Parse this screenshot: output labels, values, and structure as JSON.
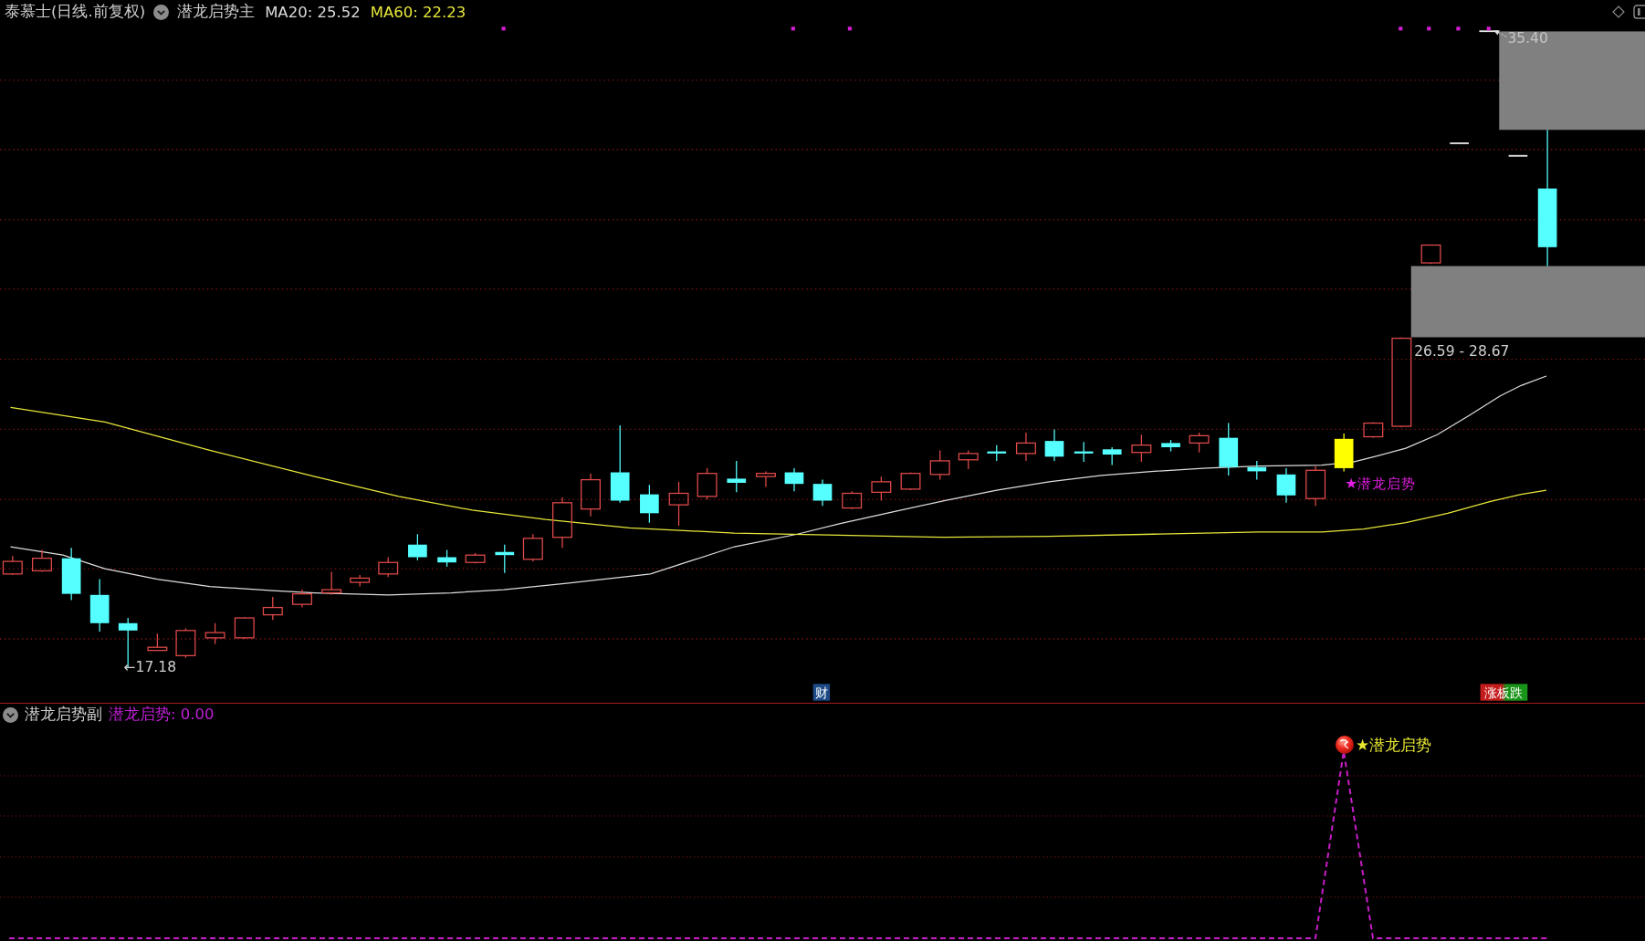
{
  "header": {
    "security": "泰慕士(日线.前复权)",
    "indicator": "潜龙启势主",
    "averages": [
      {
        "label": "MA20: 25.52",
        "color": "#dcdcdc"
      },
      {
        "label": "MA60: 22.23",
        "color": "#e6e63a"
      }
    ]
  },
  "main_chart": {
    "high_label": "35.40",
    "low_label": "←17.18",
    "zone_label": "26.59 - 28.67",
    "signal_label": "★潜龙启势",
    "finance_badge": "财",
    "limit_badge": "涨板跌"
  },
  "sub_chart": {
    "indicator": "潜龙启势副",
    "reading": "潜龙启势: 0.00",
    "signal_label": "★潜龙启势"
  }
}
